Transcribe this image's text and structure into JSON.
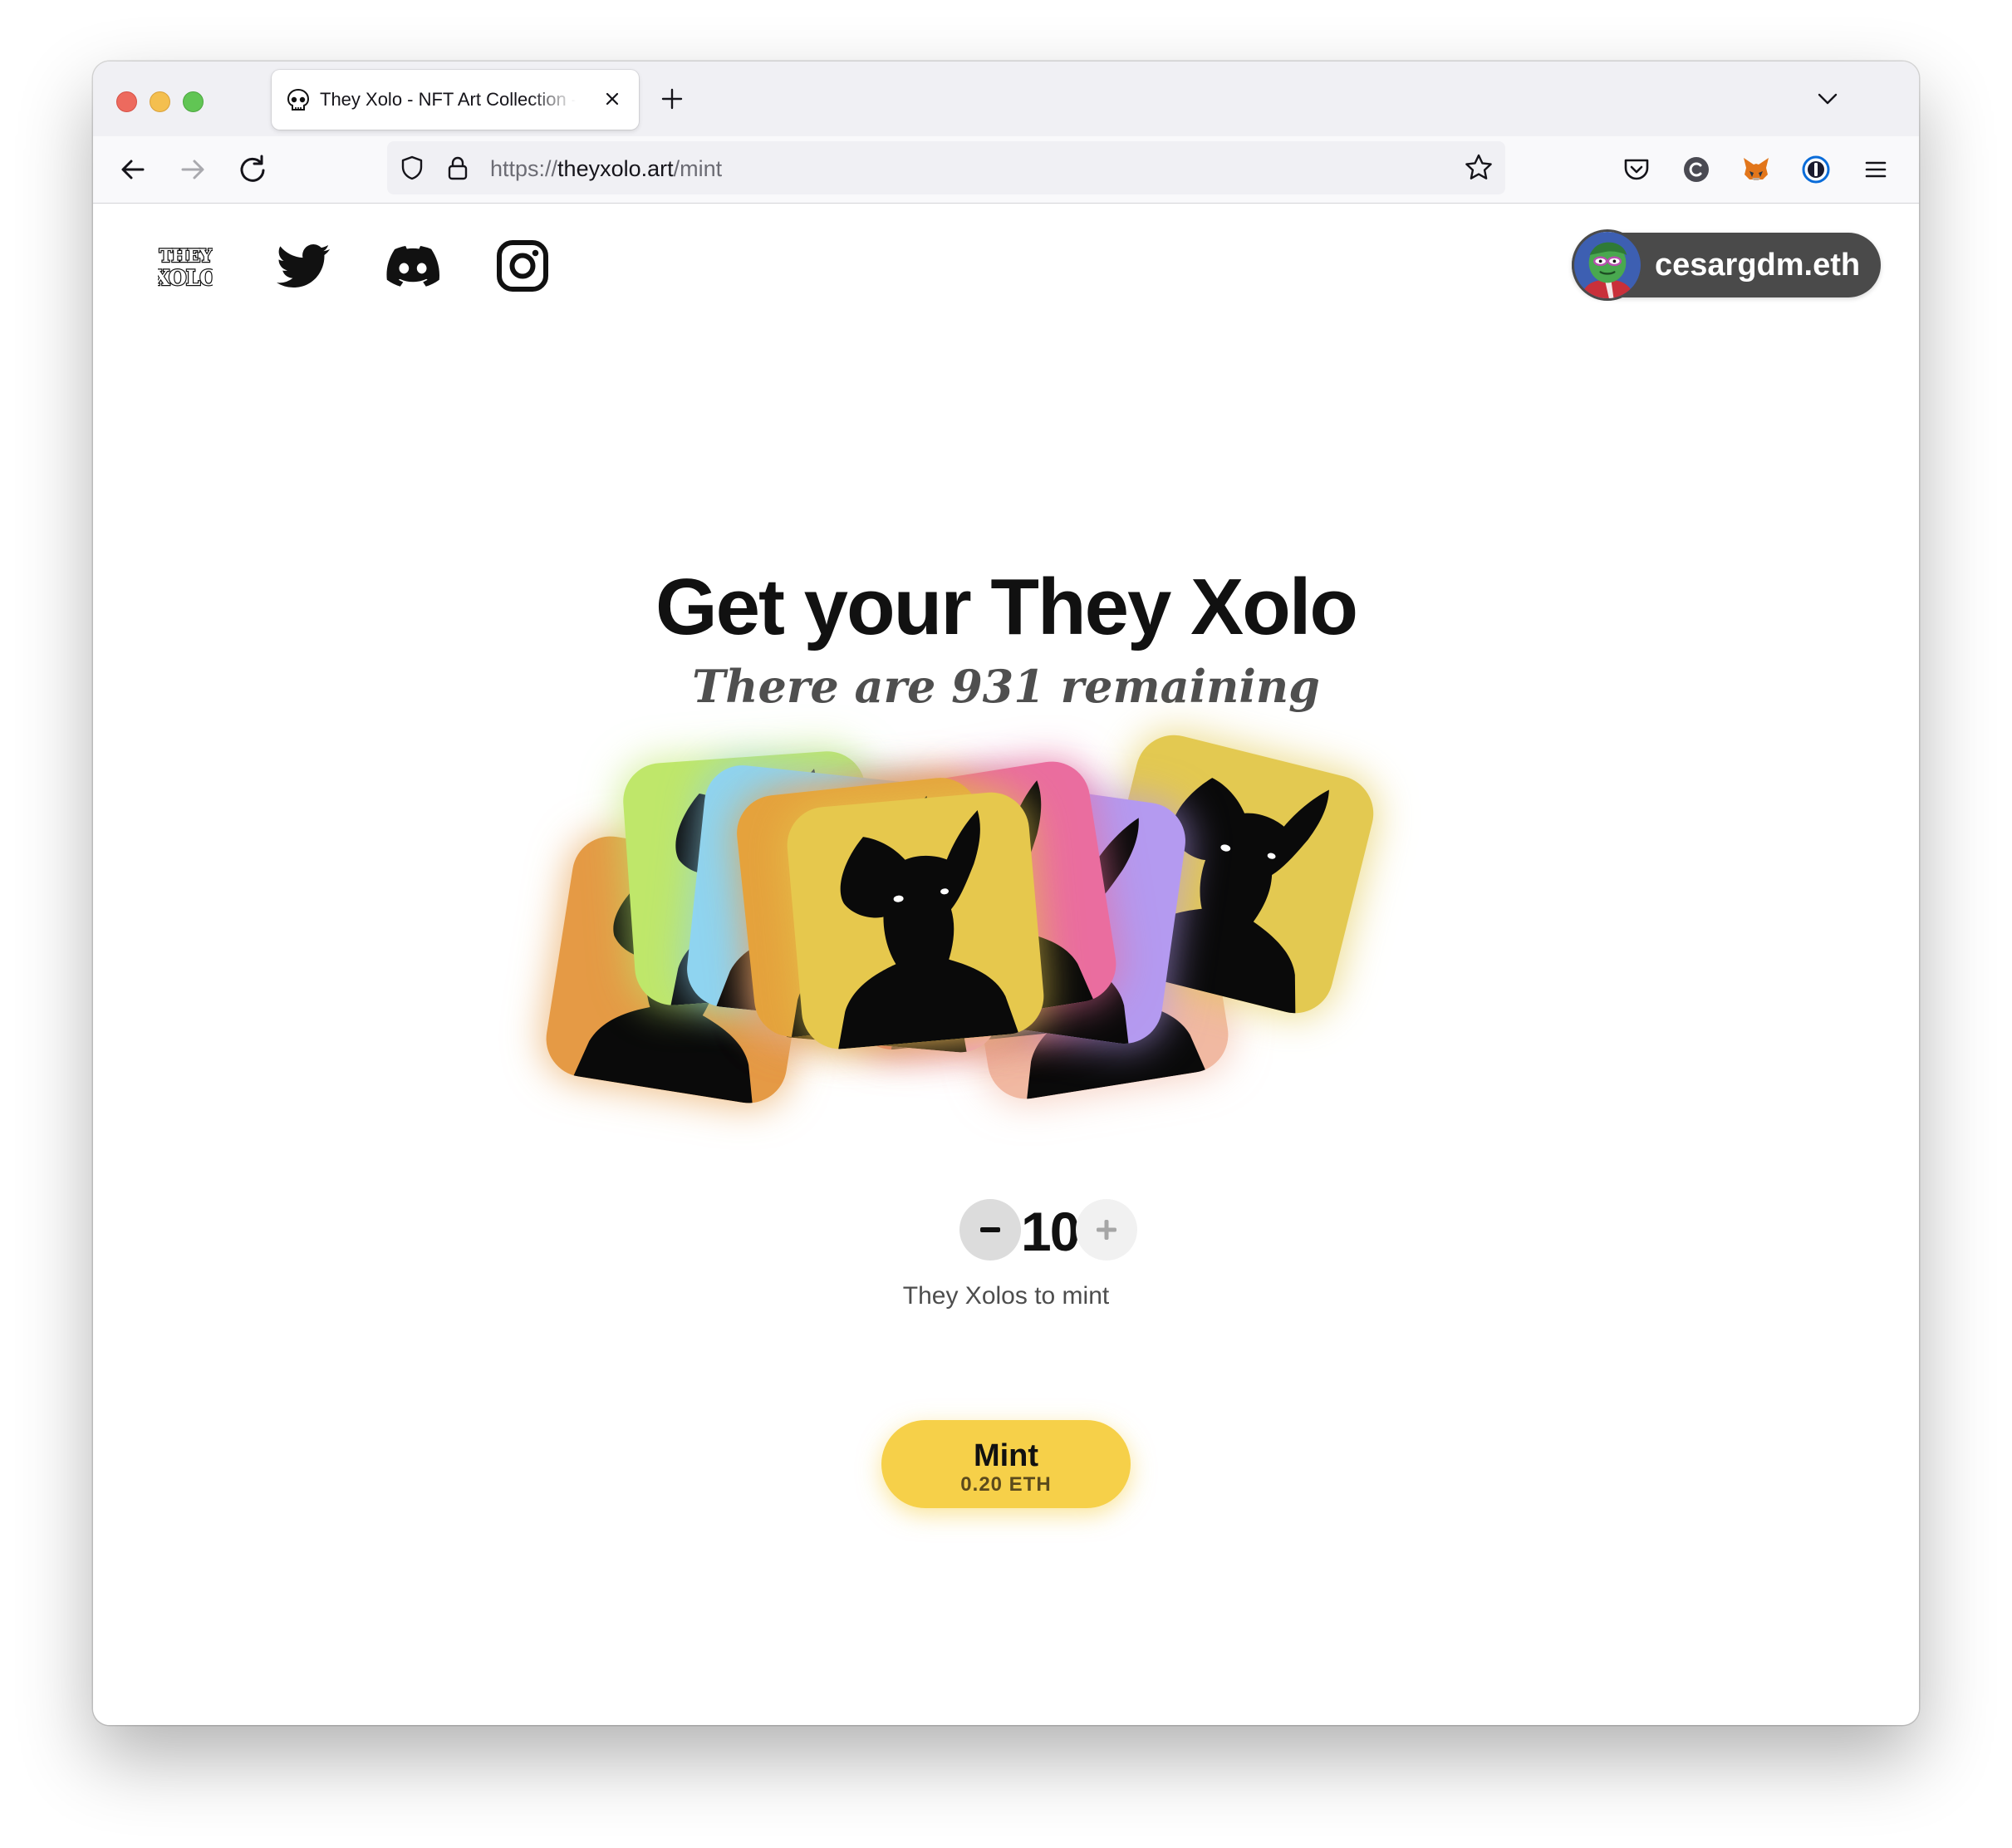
{
  "browser": {
    "tab_title": "They Xolo - NFT Art Collection - Mint",
    "url_scheme": "https://",
    "url_host": "theyxolo.art",
    "url_path": "/mint"
  },
  "header": {
    "logo_text_top": "THEY",
    "logo_text_bottom": "XOLO",
    "wallet_name": "cesargdm.eth"
  },
  "hero": {
    "title": "Get your They Xolo",
    "subtitle": "There are 931 remaining"
  },
  "cards": {
    "colors": [
      "#e59a45",
      "#f1b9a2",
      "#bfe76a",
      "#8fd4f0",
      "#f2a6c8",
      "#e5a23d",
      "#e6c84d",
      "#ea6d9f",
      "#d74545",
      "#b49af0",
      "#e3c951"
    ]
  },
  "mint": {
    "quantity": "10",
    "quantity_label": "They Xolos to mint",
    "button_label": "Mint",
    "price": "0.20 ETH",
    "accent_color": "#f6d049"
  }
}
